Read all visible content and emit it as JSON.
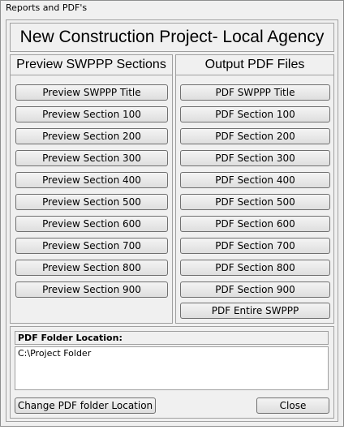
{
  "window": {
    "title": "Reports and PDF's"
  },
  "header": {
    "title": "New Construction Project- Local Agency"
  },
  "preview": {
    "title": "Preview SWPPP Sections",
    "buttons": [
      "Preview SWPPP Title",
      "Preview Section 100",
      "Preview Section 200",
      "Preview Section 300",
      "Preview Section 400",
      "Preview Section 500",
      "Preview Section 600",
      "Preview Section 700",
      "Preview Section 800",
      "Preview Section 900"
    ]
  },
  "output": {
    "title": "Output PDF Files",
    "buttons": [
      "PDF SWPPP Title",
      "PDF Section 100",
      "PDF Section 200",
      "PDF Section 300",
      "PDF Section 400",
      "PDF Section 500",
      "PDF Section 600",
      "PDF Section 700",
      "PDF Section 800",
      "PDF Section 900",
      "PDF Entire SWPPP"
    ]
  },
  "folder": {
    "label": "PDF Folder Location:",
    "path": "C:\\Project Folder",
    "change_label": "Change PDF folder Location",
    "close_label": "Close"
  }
}
